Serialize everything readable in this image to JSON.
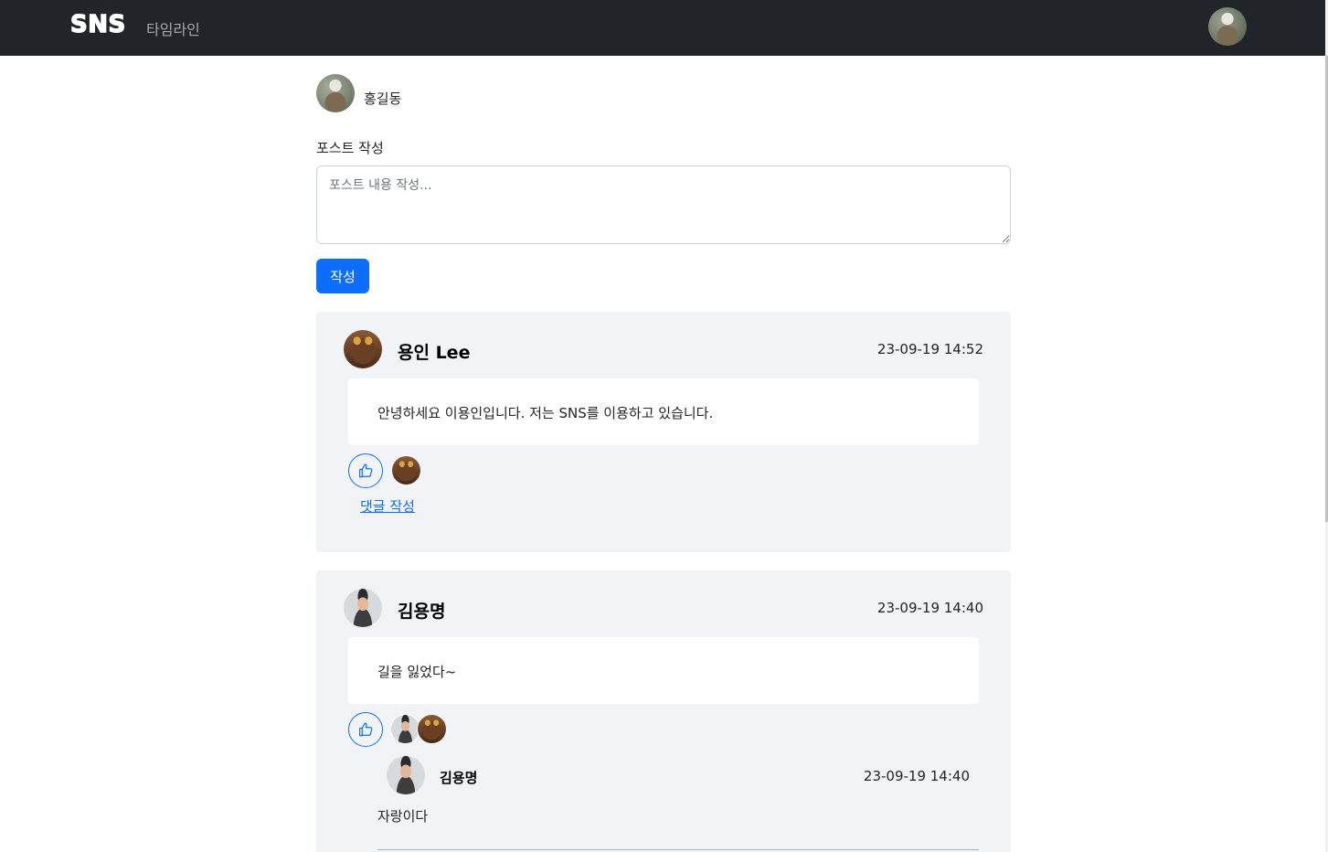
{
  "navbar": {
    "brand": "SNS",
    "links": [
      {
        "label": "타임라인"
      }
    ],
    "profile_avatar": "ostrich-avatar"
  },
  "composer": {
    "user_name": "홍길동",
    "user_avatar": "ostrich-avatar",
    "label": "포스트 작성",
    "placeholder": "포스트 내용 작성...",
    "value": "",
    "submit_label": "작성"
  },
  "posts": [
    {
      "author": "용인 Lee",
      "avatar": "lee-avatar",
      "time": "23-09-19 14:52",
      "content": "안녕하세요 이용인입니다. 저는 SNS를 이용하고 있습니다.",
      "like_icon": "thumbs-up-icon",
      "likers": [
        "lee-avatar"
      ],
      "comment_link": "댓글 작성",
      "comments": []
    },
    {
      "author": "김용명",
      "avatar": "kim-avatar",
      "time": "23-09-19 14:40",
      "content": "길을 잃었다~",
      "like_icon": "thumbs-up-icon",
      "likers": [
        "kim-avatar",
        "lee-avatar"
      ],
      "comments": [
        {
          "author": "김용명",
          "avatar": "kim-avatar",
          "time": "23-09-19 14:40",
          "text": "자랑이다"
        }
      ]
    }
  ],
  "colors": {
    "navbar_bg": "#212529",
    "primary": "#0d6efd",
    "card_bg": "#f2f3f7"
  }
}
